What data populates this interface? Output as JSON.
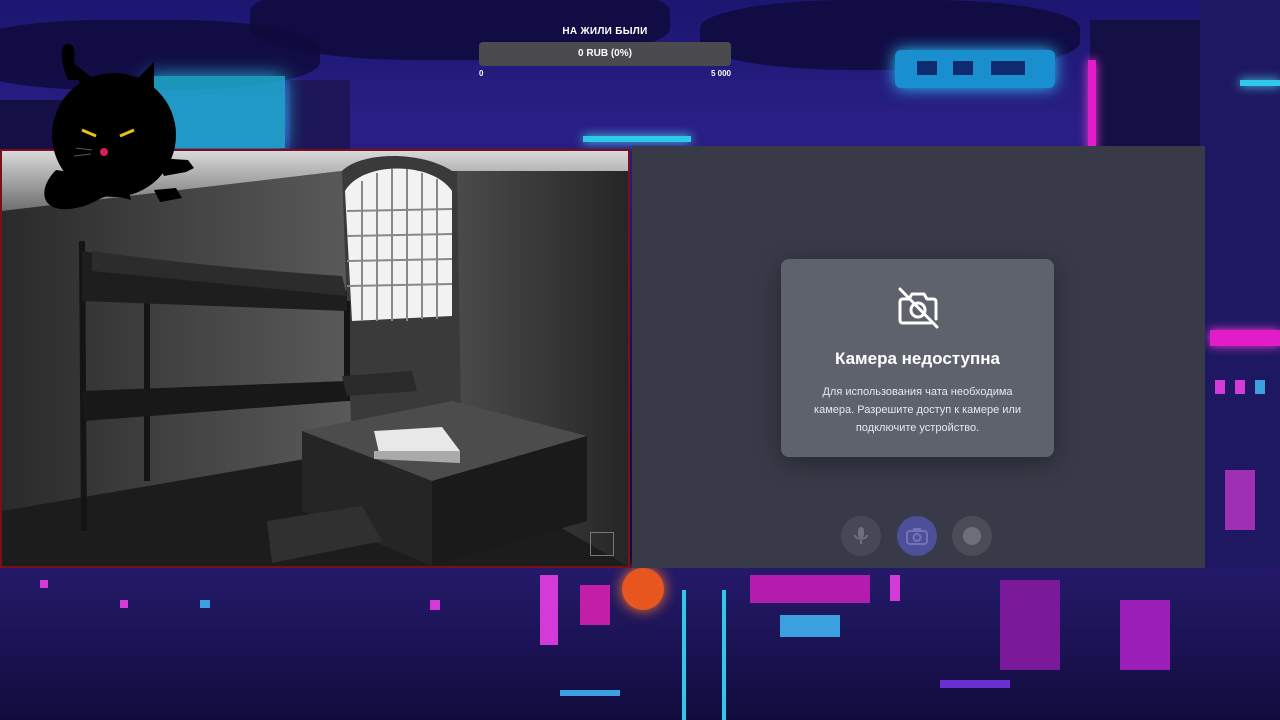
{
  "goal": {
    "title": "НА ЖИЛИ БЫЛИ",
    "amount_label": "0 RUB (0%)",
    "progress_percent": 0,
    "min_label": "0",
    "max_label": "5 000"
  },
  "camera_notice": {
    "icon": "camera-off-icon",
    "title": "Камера недоступна",
    "message": "Для использования чата необходима камера. Разрешите доступ к камере или подключите устройство."
  },
  "controls": [
    {
      "icon": "microphone-icon"
    },
    {
      "icon": "camera-icon"
    },
    {
      "icon": "record-icon"
    }
  ],
  "colors": {
    "panel_border": "#7a0f18",
    "chat_panel": "#383a48",
    "notice_card": "#5d626c",
    "camera_button": "#4d4f9a"
  }
}
